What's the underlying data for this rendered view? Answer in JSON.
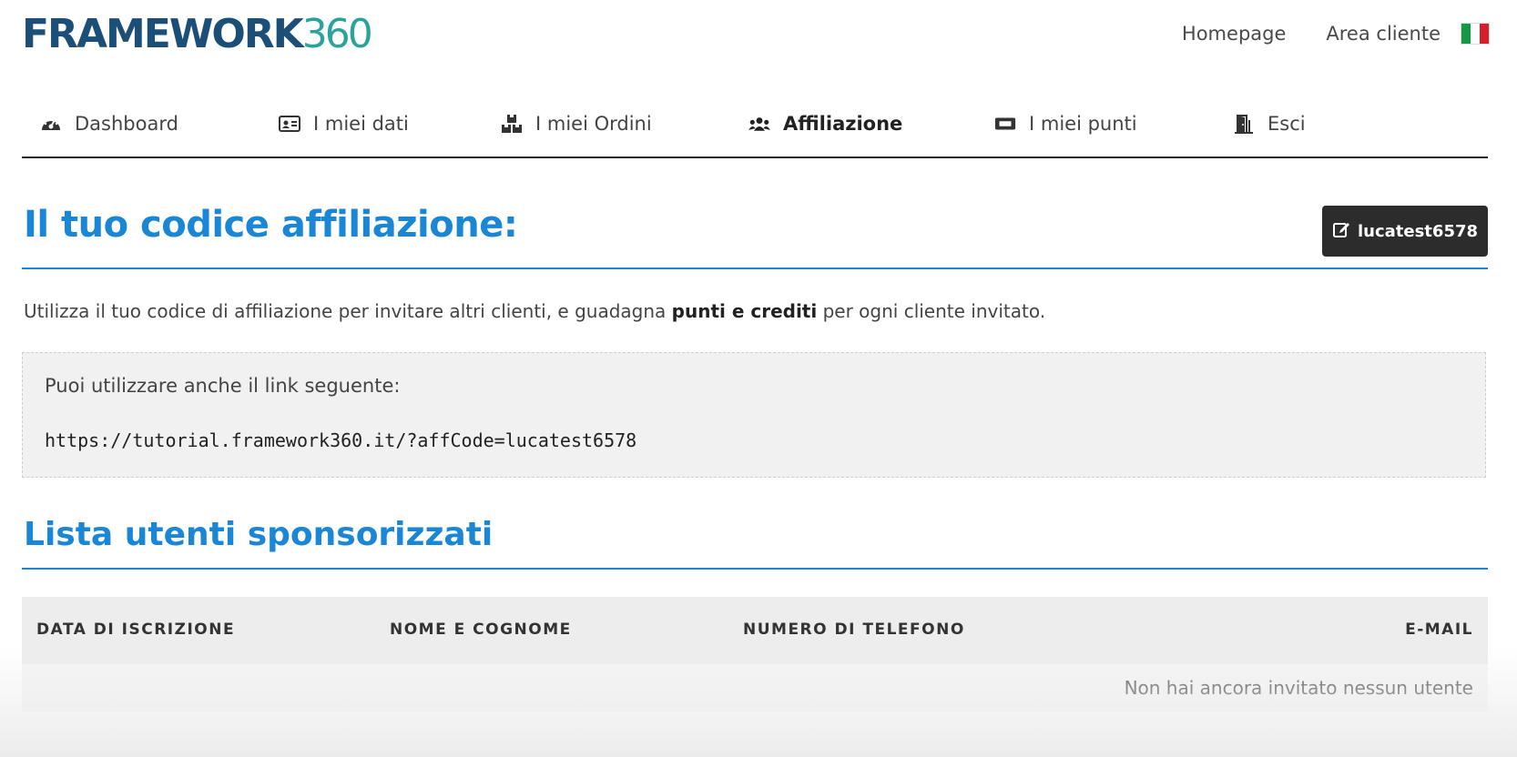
{
  "header": {
    "logo_word": "FRAMEWORK",
    "logo_number": "360",
    "links": [
      "Homepage",
      "Area cliente"
    ],
    "flag_colors": [
      "#119a43",
      "#ffffff",
      "#d61f2a"
    ],
    "language_flag_icon": "italy-flag-icon"
  },
  "nav": {
    "items": [
      {
        "label": "Dashboard",
        "icon": "dashboard-gauge-icon"
      },
      {
        "label": "I miei dati",
        "icon": "id-card-icon"
      },
      {
        "label": "I miei Ordini",
        "icon": "boxes-icon"
      },
      {
        "label": "Affiliazione",
        "icon": "users-icon",
        "active": true
      },
      {
        "label": "I miei punti",
        "icon": "ticket-icon"
      },
      {
        "label": "Esci",
        "icon": "door-exit-icon"
      }
    ]
  },
  "affiliation": {
    "title": "Il tuo codice affiliazione:",
    "code_button": "lucatest6578",
    "code_button_icon": "edit-icon",
    "intro_before": "Utilizza il tuo codice di affiliazione per invitare altri clienti, e guadagna",
    "intro_bold": "punti e crediti",
    "intro_after": "per ogni cliente invitato.",
    "link_label": "Puoi utilizzare anche il link seguente:",
    "link_url": "https://tutorial.framework360.it/?affCode=lucatest6578"
  },
  "sponsored": {
    "title": "Lista utenti sponsorizzati",
    "columns": [
      "DATA DI ISCRIZIONE",
      "NOME E COGNOME",
      "NUMERO DI TELEFONO",
      "E-MAIL"
    ],
    "empty_message": "Non hai ancora invitato nessun utente"
  },
  "colors": {
    "accent_blue": "#1a86d6",
    "logo_navy": "#1c4f78",
    "logo_teal": "#2aa39a",
    "button_dark": "#2c2c2c"
  }
}
